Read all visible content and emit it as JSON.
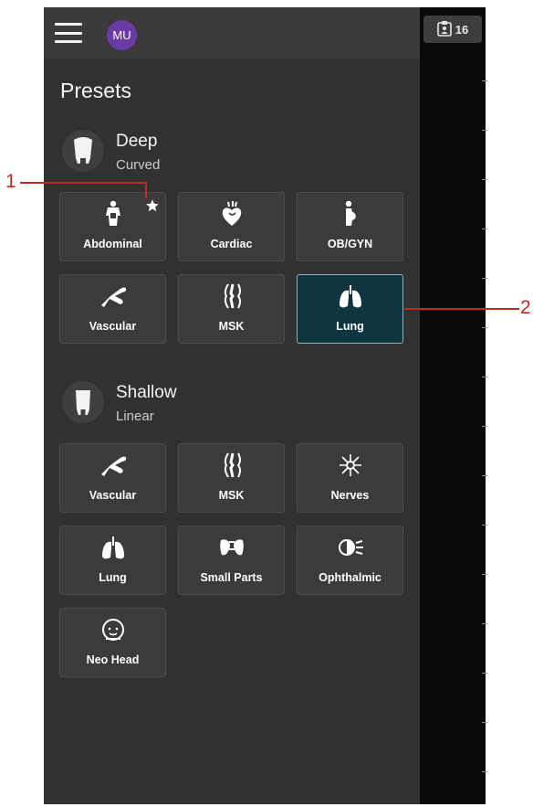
{
  "header": {
    "avatar_initials": "MU",
    "badge_count": "16"
  },
  "panel": {
    "title": "Presets"
  },
  "deep": {
    "name": "Deep",
    "probe": "Curved",
    "presets": [
      {
        "label": "Abdominal",
        "icon": "abdominal-icon",
        "favorite": true
      },
      {
        "label": "Cardiac",
        "icon": "heart-icon"
      },
      {
        "label": "OB/GYN",
        "icon": "pregnant-icon"
      },
      {
        "label": "Vascular",
        "icon": "vessel-icon"
      },
      {
        "label": "MSK",
        "icon": "knee-joint-icon"
      },
      {
        "label": "Lung",
        "icon": "lungs-icon",
        "selected": true
      }
    ]
  },
  "shallow": {
    "name": "Shallow",
    "probe": "Linear",
    "presets": [
      {
        "label": "Vascular",
        "icon": "vessel-icon"
      },
      {
        "label": "MSK",
        "icon": "knee-joint-icon"
      },
      {
        "label": "Nerves",
        "icon": "nerve-icon"
      },
      {
        "label": "Lung",
        "icon": "lungs-icon"
      },
      {
        "label": "Small Parts",
        "icon": "small-parts-icon"
      },
      {
        "label": "Ophthalmic",
        "icon": "eye-icon"
      },
      {
        "label": "Neo Head",
        "icon": "baby-head-icon"
      }
    ]
  },
  "callouts": [
    {
      "label": "1"
    },
    {
      "label": "2"
    }
  ],
  "colors": {
    "panel": "#313131",
    "tile": "#3b3b3b",
    "selected_tile": "#0e3540",
    "avatar": "#6a3aa5",
    "callout": "#c62828"
  }
}
